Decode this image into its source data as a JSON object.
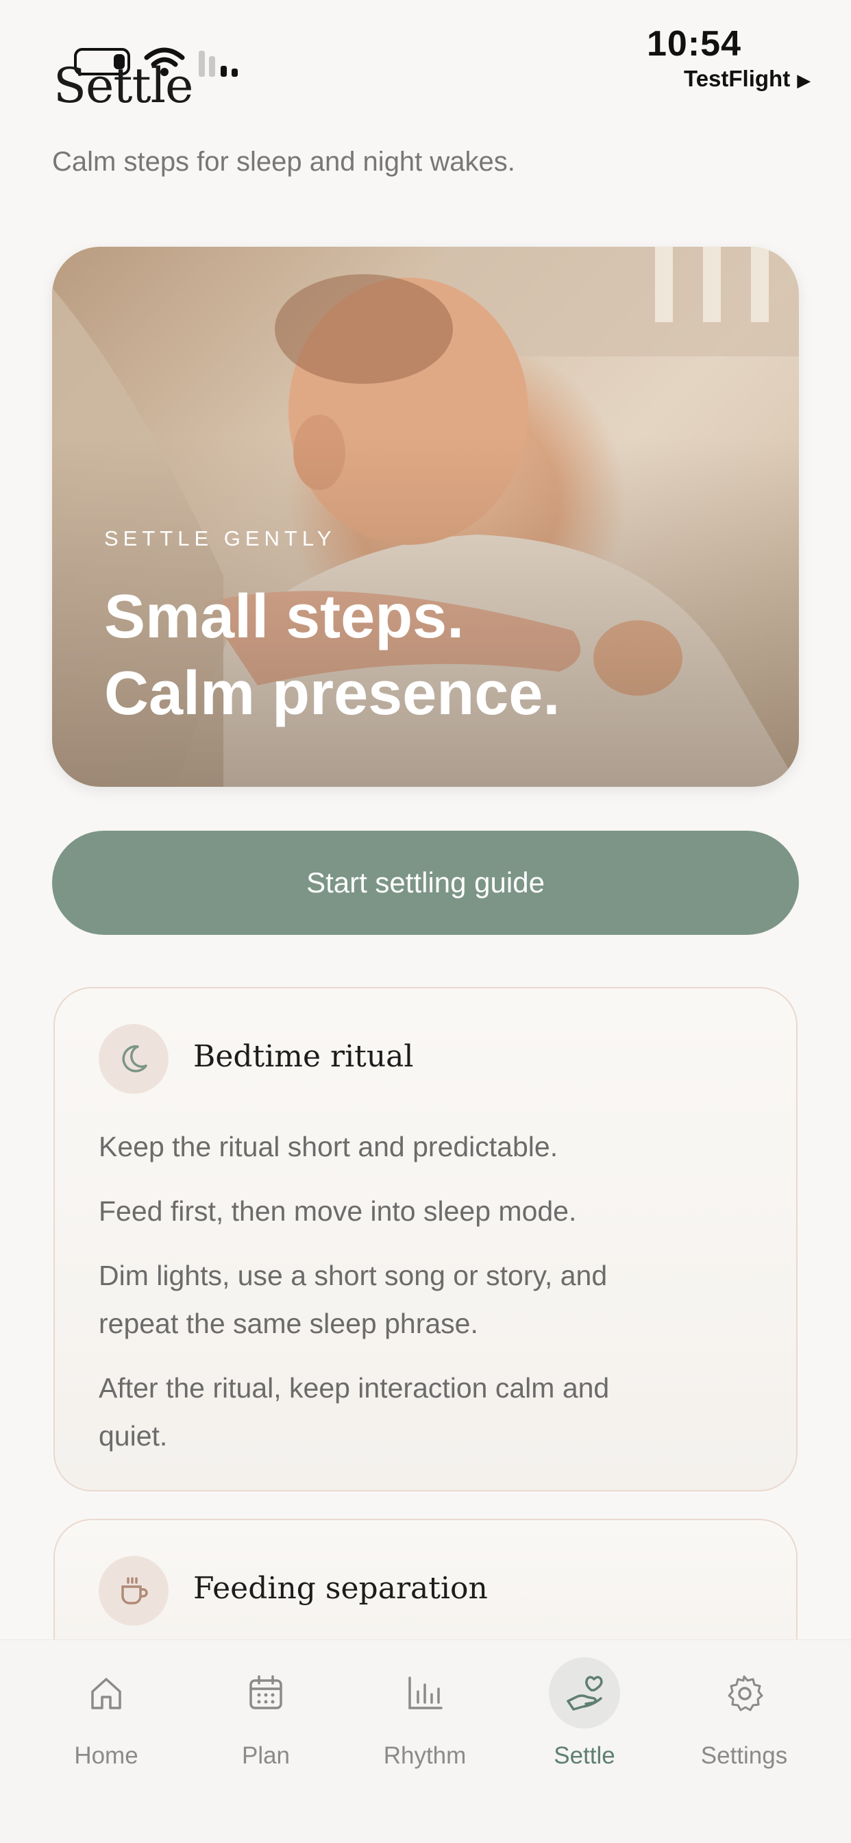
{
  "status": {
    "time": "10:54",
    "testflight": "TestFlight",
    "play_glyph": "▶"
  },
  "header": {
    "title": "Settle",
    "subtitle": "Calm steps for sleep and night wakes."
  },
  "hero": {
    "eyebrow": "SETTLE GENTLY",
    "title_line1": "Small steps.",
    "title_line2": "Calm presence."
  },
  "primary_button": {
    "label": "Start settling guide"
  },
  "cards": [
    {
      "icon": "moon-icon",
      "title": "Bedtime ritual",
      "lines": [
        "Keep the ritual short and predictable.",
        "Feed first, then move into sleep mode.",
        "Dim lights, use a short song or story, and",
        "repeat the same sleep phrase.",
        "After the ritual, keep interaction calm and",
        "quiet."
      ]
    },
    {
      "icon": "cup-icon",
      "title": "Feeding separation"
    }
  ],
  "tabs": [
    {
      "icon": "home-icon",
      "label": "Home"
    },
    {
      "icon": "calendar-icon",
      "label": "Plan"
    },
    {
      "icon": "bar-chart-icon",
      "label": "Rhythm"
    },
    {
      "icon": "hand-heart-icon",
      "label": "Settle",
      "active": true
    },
    {
      "icon": "gear-icon",
      "label": "Settings"
    }
  ],
  "colors": {
    "accent": "#7c9587",
    "active_tab": "#5f7e72",
    "card_border": "#ead9cf"
  }
}
